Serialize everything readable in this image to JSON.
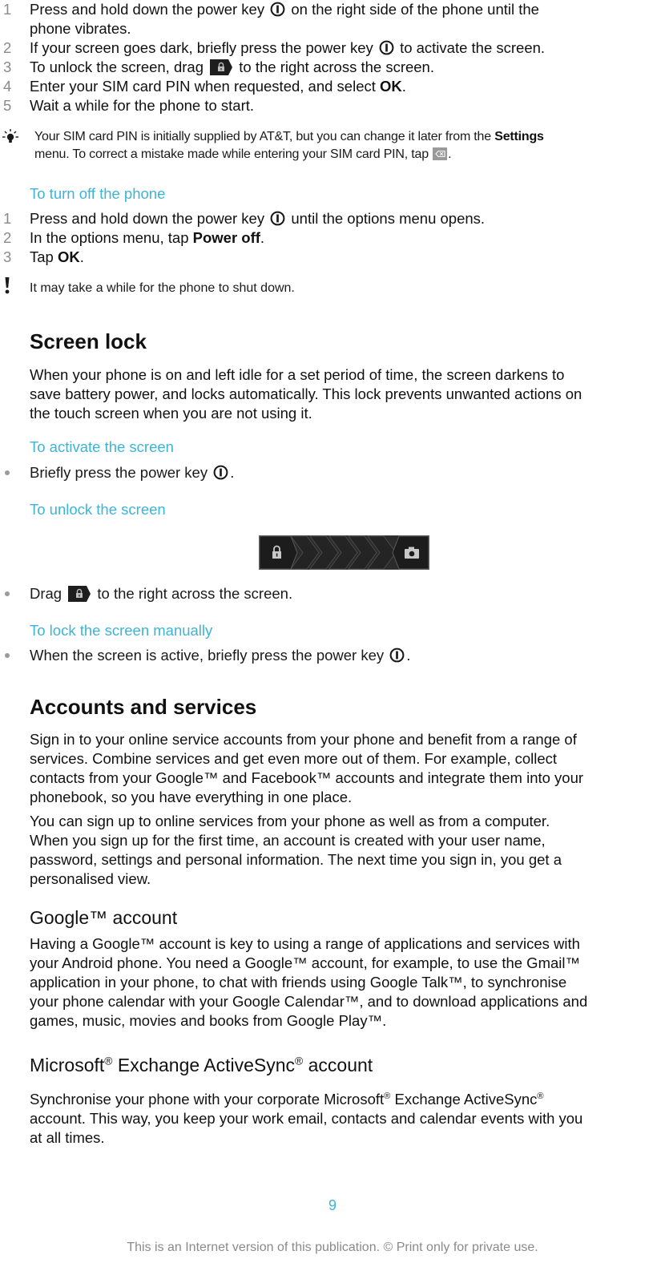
{
  "startup_steps": [
    {
      "num": "1",
      "line1_pre": "Press and hold down the power key",
      "line1_post": "on the right side of the phone until the",
      "line2": "phone vibrates."
    },
    {
      "num": "2",
      "pre": "If your screen goes dark, briefly press the power key",
      "post": "to activate the screen."
    },
    {
      "num": "3",
      "pre": "To unlock the screen, drag",
      "post": "to the right across the screen."
    },
    {
      "num": "4",
      "pre": "Enter your SIM card PIN when requested, and select",
      "bold": "OK",
      "post": "."
    },
    {
      "num": "5",
      "text": "Wait a while for the phone to start."
    }
  ],
  "tip": {
    "icon": "lightbulb-icon",
    "line1_pre": "Your SIM card PIN is initially supplied by AT&T, but you can change it later from the",
    "line1_bold": "Settings",
    "line2_pre": "menu. To correct a mistake made while entering your SIM card PIN, tap",
    "line2_post": "."
  },
  "turn_off": {
    "heading": "To turn off the phone",
    "steps": [
      {
        "num": "1",
        "pre": "Press and hold down the power key",
        "post": "until the options menu opens."
      },
      {
        "num": "2",
        "pre": "In the options menu, tap",
        "bold": "Power off",
        "post": "."
      },
      {
        "num": "3",
        "pre": "Tap",
        "bold": "OK",
        "post": "."
      }
    ],
    "warning": "It may take a while for the phone to shut down."
  },
  "screen_lock": {
    "heading": "Screen lock",
    "body": [
      "When your phone is on and left idle for a set period of time, the screen darkens to",
      "save battery power, and locks automatically. This lock prevents unwanted actions on",
      "the touch screen when you are not using it."
    ],
    "activate_heading": "To activate the screen",
    "activate_bullet_pre": "Briefly press the power key",
    "activate_bullet_post": ".",
    "unlock_heading": "To unlock the screen",
    "unlock_bullet_pre": "Drag",
    "unlock_bullet_post": "to the right across the screen.",
    "lock_manual_heading": "To lock the screen manually",
    "lock_manual_bullet_pre": "When the screen is active, briefly press the power key",
    "lock_manual_bullet_post": "."
  },
  "accounts": {
    "heading": "Accounts and services",
    "para1": [
      "Sign in to your online service accounts from your phone and benefit from a range of",
      "services. Combine services and get even more out of them. For example, collect",
      "contacts from your Google™ and Facebook™ accounts and integrate them into your",
      "phonebook, so you have everything in one place."
    ],
    "para2": [
      "You can sign up to online services from your phone as well as from a computer.",
      "When you sign up for the first time, an account is created with your user name,",
      "password, settings and personal information. The next time you sign in, you get a",
      "personalised view."
    ]
  },
  "google": {
    "heading": "Google™ account",
    "body": [
      "Having a Google™ account is key to using a range of applications and services with",
      "your Android phone. You need a Google™ account, for example, to use the Gmail™",
      "application in your phone, to chat with friends using Google Talk™, to synchronise",
      "your phone calendar with your Google Calendar™, and to download applications and",
      "games, music, movies and books from Google Play™."
    ]
  },
  "exchange": {
    "heading_a": "Microsoft",
    "heading_b": " Exchange ActiveSync",
    "heading_c": " account",
    "reg": "®",
    "body1_a": "Synchronise your phone with your corporate Microsoft",
    "body1_b": " Exchange ActiveSync",
    "body2": "account. This way, you keep your work email, contacts and calendar events with you",
    "body3": "at all times."
  },
  "footer": {
    "page_number": "9",
    "notice": "This is an Internet version of this publication. © Print only for private use."
  },
  "colors": {
    "accent": "#3cb4d8",
    "text": "#111111",
    "muted": "#8a8a8a"
  }
}
